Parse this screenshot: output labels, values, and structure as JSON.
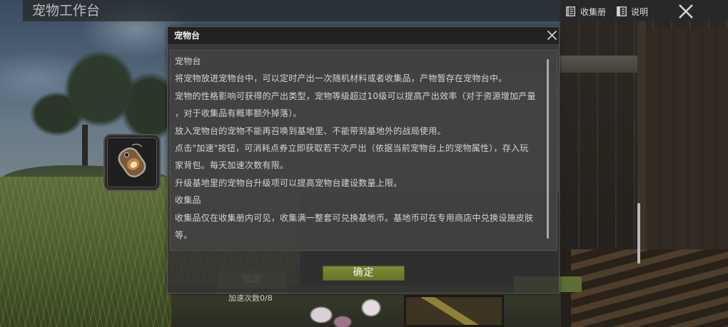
{
  "top_bar": {
    "title": "宠物工作台",
    "collection_label": "收集册",
    "help_label": "说明"
  },
  "background_controls": {
    "speed_up_label": "加速",
    "speed_up_count_label": "加速次数",
    "speed_up_count": "0/8"
  },
  "dialog": {
    "title": "宠物台",
    "lines": [
      "宠物台",
      "将宠物放进宠物台中，可以定时产出一次随机材料或者收集品，产物暂存在宠物台中。",
      "宠物的性格影响可获得的产出类型，宠物等级超过10级可以提高产出效率（对于资源增加产量",
      "，对于收集品有概率额外掉落）。",
      "放入宠物台的宠物不能再召唤到基地里、不能带到基地外的战局使用。",
      "点击\"加速\"按钮，可消耗点券立即获取若干次产出（依据当前宠物台上的宠物属性），存入玩",
      "家背包。每天加速次数有限。",
      "升级基地里的宠物台升级项可以提高宠物台建设数量上限。",
      "收集品",
      "收集品仅在收集册内可见，收集满一整套可兑换基地币。基地币可在专用商店中兑换设施皮肤",
      "等。"
    ],
    "confirm_label": "确定"
  },
  "icons": {
    "collection": "book-list-icon",
    "help": "manual-icon",
    "close": "close-icon",
    "dialog_close": "close-icon",
    "pet_slot": "dog-tag-icon"
  },
  "colors": {
    "confirm_button": "#6f7e2f",
    "speed_up_button": "#5f6e35",
    "dialog_background": "#333333",
    "dialog_text": "#d4d4d4"
  }
}
